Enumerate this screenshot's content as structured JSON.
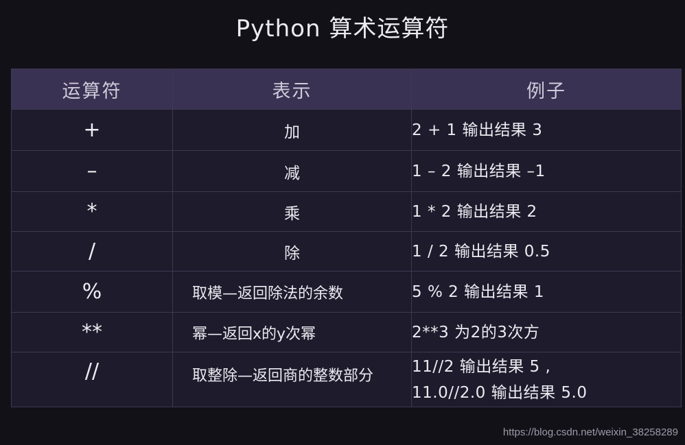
{
  "title": "Python 算术运算符",
  "table": {
    "headers": [
      "运算符",
      "表示",
      "例子"
    ],
    "rows": [
      {
        "op": "+",
        "desc": "加",
        "example": [
          "2 + 1 输出结果 3"
        ]
      },
      {
        "op": "–",
        "desc": "减",
        "example": [
          "1 – 2 输出结果 –1"
        ]
      },
      {
        "op": "*",
        "desc": "乘",
        "example": [
          "1 * 2 输出结果 2"
        ]
      },
      {
        "op": "/",
        "desc": "除",
        "example": [
          "1 / 2 输出结果 0.5"
        ]
      },
      {
        "op": "%",
        "desc": "取模—返回除法的余数",
        "example": [
          "5 % 2 输出结果 1"
        ]
      },
      {
        "op": "**",
        "desc": "幂—返回x的y次幂",
        "example": [
          "2**3 为2的3次方"
        ]
      },
      {
        "op": "//",
        "desc": "取整除—返回商的整数部分",
        "example": [
          "11//2 输出结果 5 ,",
          "11.0//2.0 输出结果 5.0"
        ]
      }
    ]
  },
  "watermark": "https://blog.csdn.net/weixin_38258289"
}
